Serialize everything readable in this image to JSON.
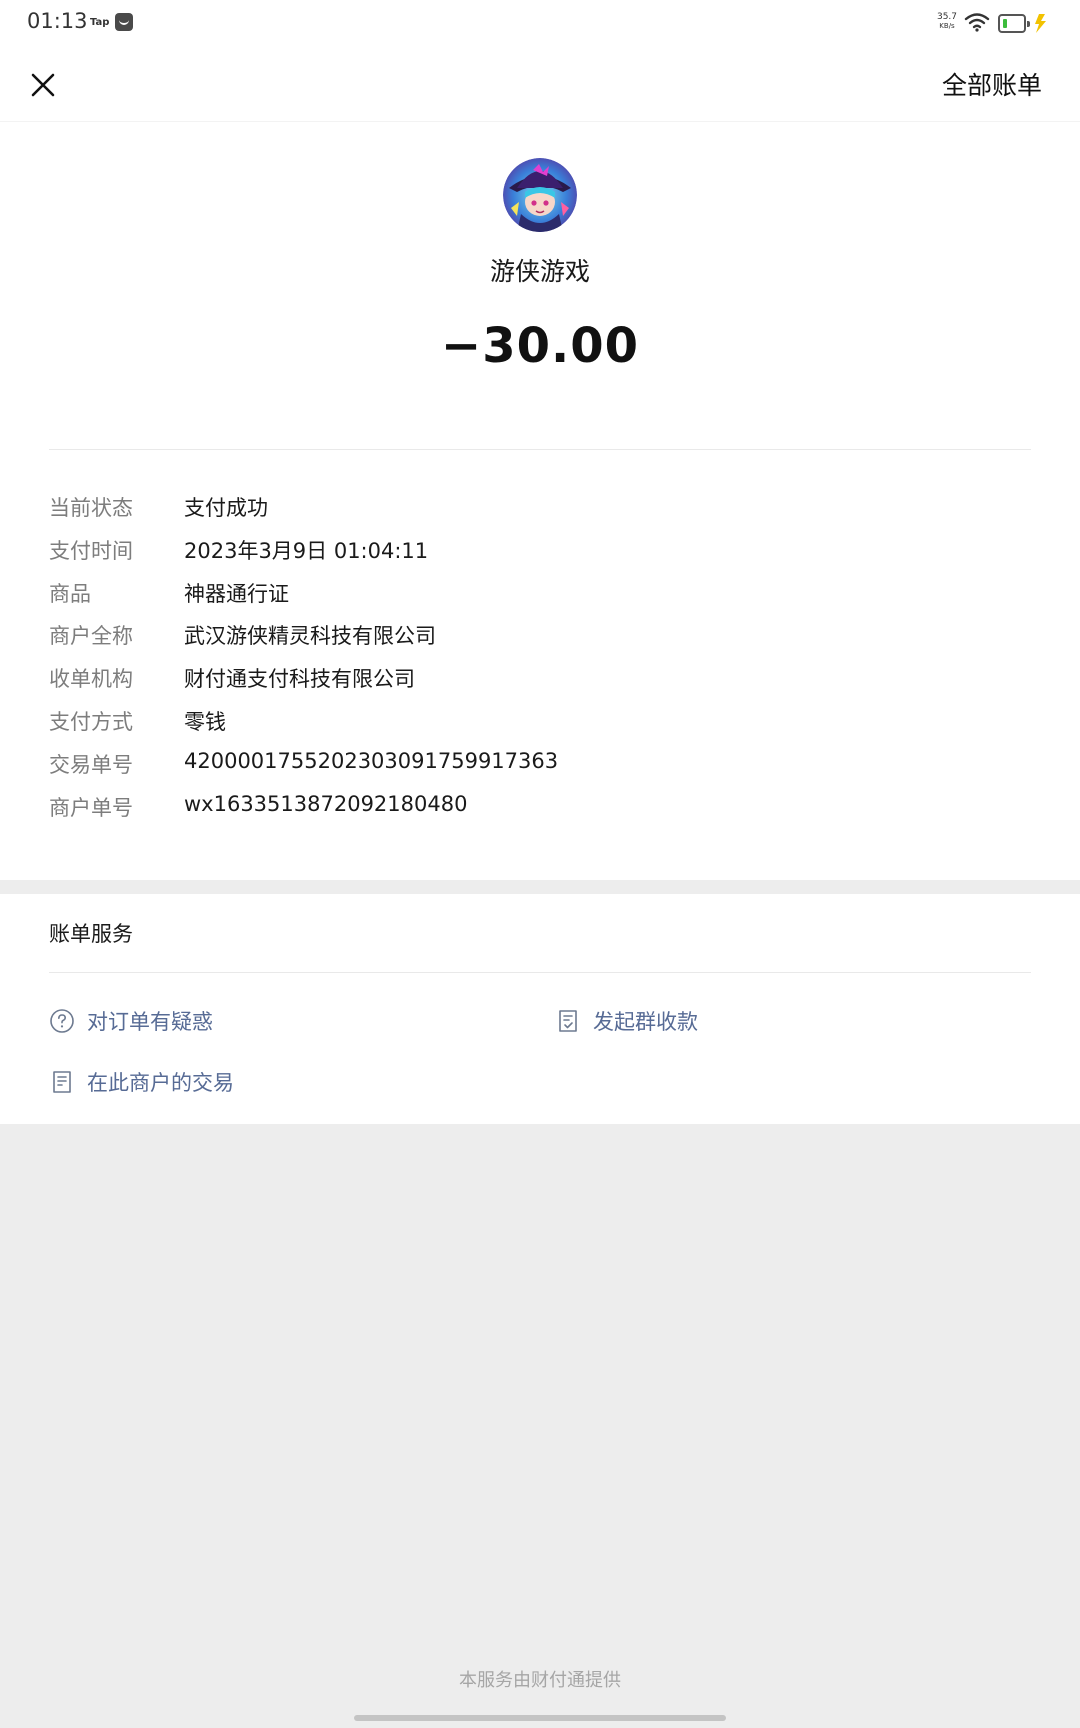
{
  "status_bar": {
    "time": "01:13",
    "app_label": "Tap",
    "net_speed_value": "35.7",
    "net_speed_unit": "KB/s",
    "battery_color": "#3cbc3c"
  },
  "nav": {
    "close_icon": "close-icon",
    "all_bills_label": "全部账单"
  },
  "merchant": {
    "name": "游侠游戏",
    "amount": "−30.00"
  },
  "details": [
    {
      "label": "当前状态",
      "value": "支付成功"
    },
    {
      "label": "支付时间",
      "value": "2023年3月9日 01:04:11"
    },
    {
      "label": "商品",
      "value": "神器通行证"
    },
    {
      "label": "商户全称",
      "value": "武汉游侠精灵科技有限公司"
    },
    {
      "label": "收单机构",
      "value": "财付通支付科技有限公司"
    },
    {
      "label": "支付方式",
      "value": "零钱"
    },
    {
      "label": "交易单号",
      "value": "4200001755202303091759917363"
    },
    {
      "label": "商户单号",
      "value": "wx1633513872092180480"
    }
  ],
  "services": {
    "title": "账单服务",
    "links": [
      {
        "label": "对订单有疑惑",
        "icon": "question-circle-icon"
      },
      {
        "label": "发起群收款",
        "icon": "group-receipt-icon"
      },
      {
        "label": "在此商户的交易",
        "icon": "document-list-icon"
      }
    ]
  },
  "footer": {
    "text": "本服务由财付通提供"
  },
  "colors": {
    "link": "#576b95",
    "label_gray": "#7d7d7d",
    "page_bg": "#ededed"
  }
}
